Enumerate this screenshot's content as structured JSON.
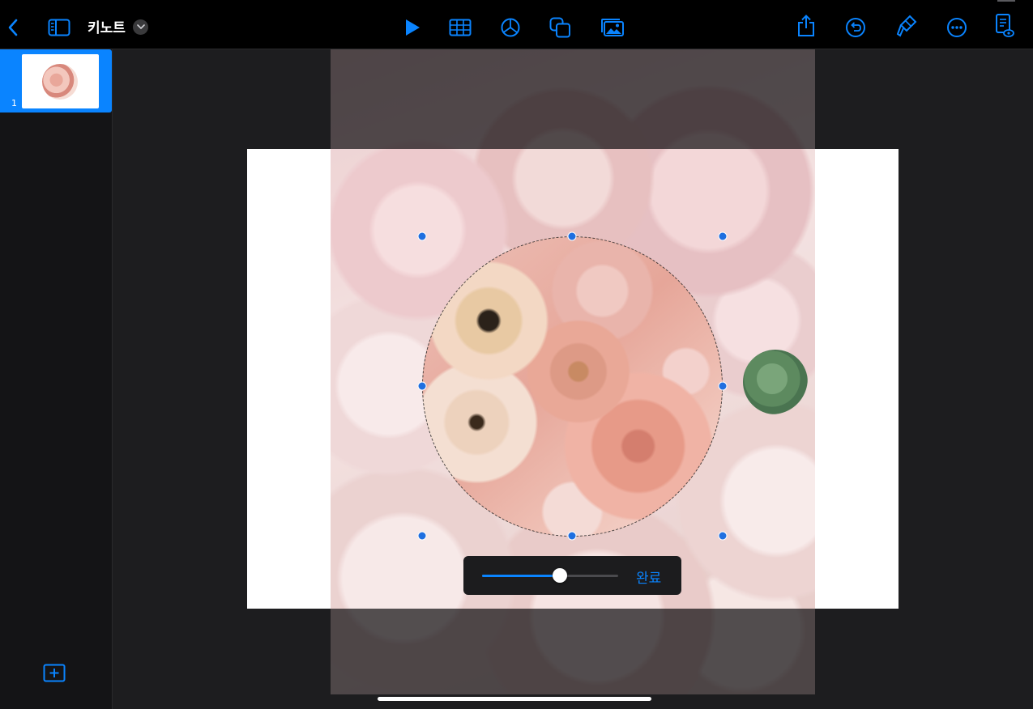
{
  "toolbar": {
    "doc_title": "키노트",
    "icons": [
      "back-chevron-icon",
      "sidebar-toggle-icon",
      "play-icon",
      "table-icon",
      "chart-icon",
      "shapes-icon",
      "media-icon",
      "share-icon",
      "undo-icon",
      "format-brush-icon",
      "more-icon",
      "document-options-icon"
    ],
    "accent": "#0a84ff"
  },
  "sidebar": {
    "slides": [
      {
        "number": "1",
        "selected": true
      }
    ]
  },
  "mask_control": {
    "zoom_fraction": 0.57,
    "done_label": "완료"
  }
}
